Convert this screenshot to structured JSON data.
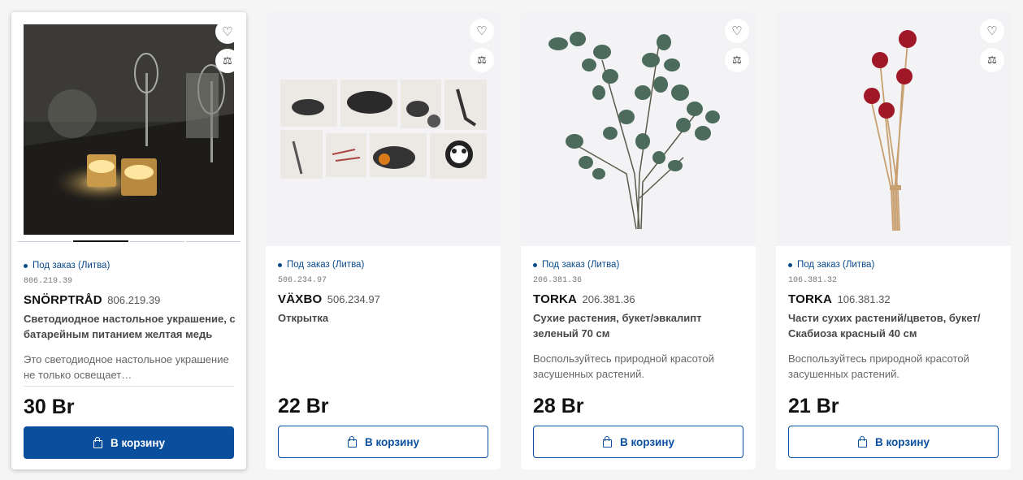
{
  "products": [
    {
      "stock": "Под заказ (Литва)",
      "sku_small": "806.219.39",
      "brand": "SNÖRPTRÅD",
      "sku": "806.219.39",
      "description": "Светодиодное настольное украшение, с батарейным питанием желтая медь",
      "teaser": "Это светодиодное настольное украшение не только освещает…",
      "price": "30 Br",
      "cart_label": "В корзину"
    },
    {
      "stock": "Под заказ (Литва)",
      "sku_small": "506.234.97",
      "brand": "VÄXBO",
      "sku": "506.234.97",
      "description": "Открытка",
      "teaser": "",
      "price": "22 Br",
      "cart_label": "В корзину"
    },
    {
      "stock": "Под заказ (Литва)",
      "sku_small": "206.381.36",
      "brand": "TORKA",
      "sku": "206.381.36",
      "description": "Сухие растения, букет/эвкалипт зеленый 70 см",
      "teaser": "Воспользуйтесь природной красотой засушенных растений.",
      "price": "28 Br",
      "cart_label": "В корзину"
    },
    {
      "stock": "Под заказ (Литва)",
      "sku_small": "106.381.32",
      "brand": "TORKA",
      "sku": "106.381.32",
      "description": "Части сухих растений/цветов, букет/Скабиоза красный 40 см",
      "teaser": "Воспользуйтесь природной красотой засушенных растений.",
      "price": "21 Br",
      "cart_label": "В корзину"
    }
  ],
  "icons": {
    "favorite": "heart-icon",
    "compare": "scale-icon",
    "cart": "shopping-bag-icon"
  },
  "colors": {
    "accent": "#0a4f9e",
    "stock": "#0a4a8a"
  }
}
